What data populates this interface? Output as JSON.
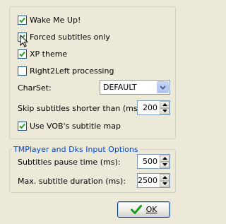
{
  "options": {
    "wake_me_up": {
      "label": "Wake Me Up!",
      "checked": true
    },
    "forced_subtitles": {
      "label": "Forced subtitles only",
      "checked": true
    },
    "xp_theme": {
      "label": "XP theme",
      "checked": true
    },
    "right2left": {
      "label": "Right2Left processing",
      "checked": false
    },
    "charset": {
      "label": "CharSet:",
      "value": "DEFAULT"
    },
    "skip_shorter": {
      "label": "Skip subtitles shorter than (ms):",
      "value": "200"
    },
    "vob_map": {
      "label": "Use VOB's subtitle map",
      "checked": true
    }
  },
  "tmplayer": {
    "title": "TMPlayer and Dks Input Options",
    "pause_time": {
      "label": "Subtitles pause time (ms):",
      "value": "500"
    },
    "max_duration": {
      "label": "Max. subtitle duration (ms):",
      "value": "2500"
    }
  },
  "ok_label": "OK",
  "colors": {
    "check_green": "#21a121",
    "accent_blue": "#0046d5"
  }
}
